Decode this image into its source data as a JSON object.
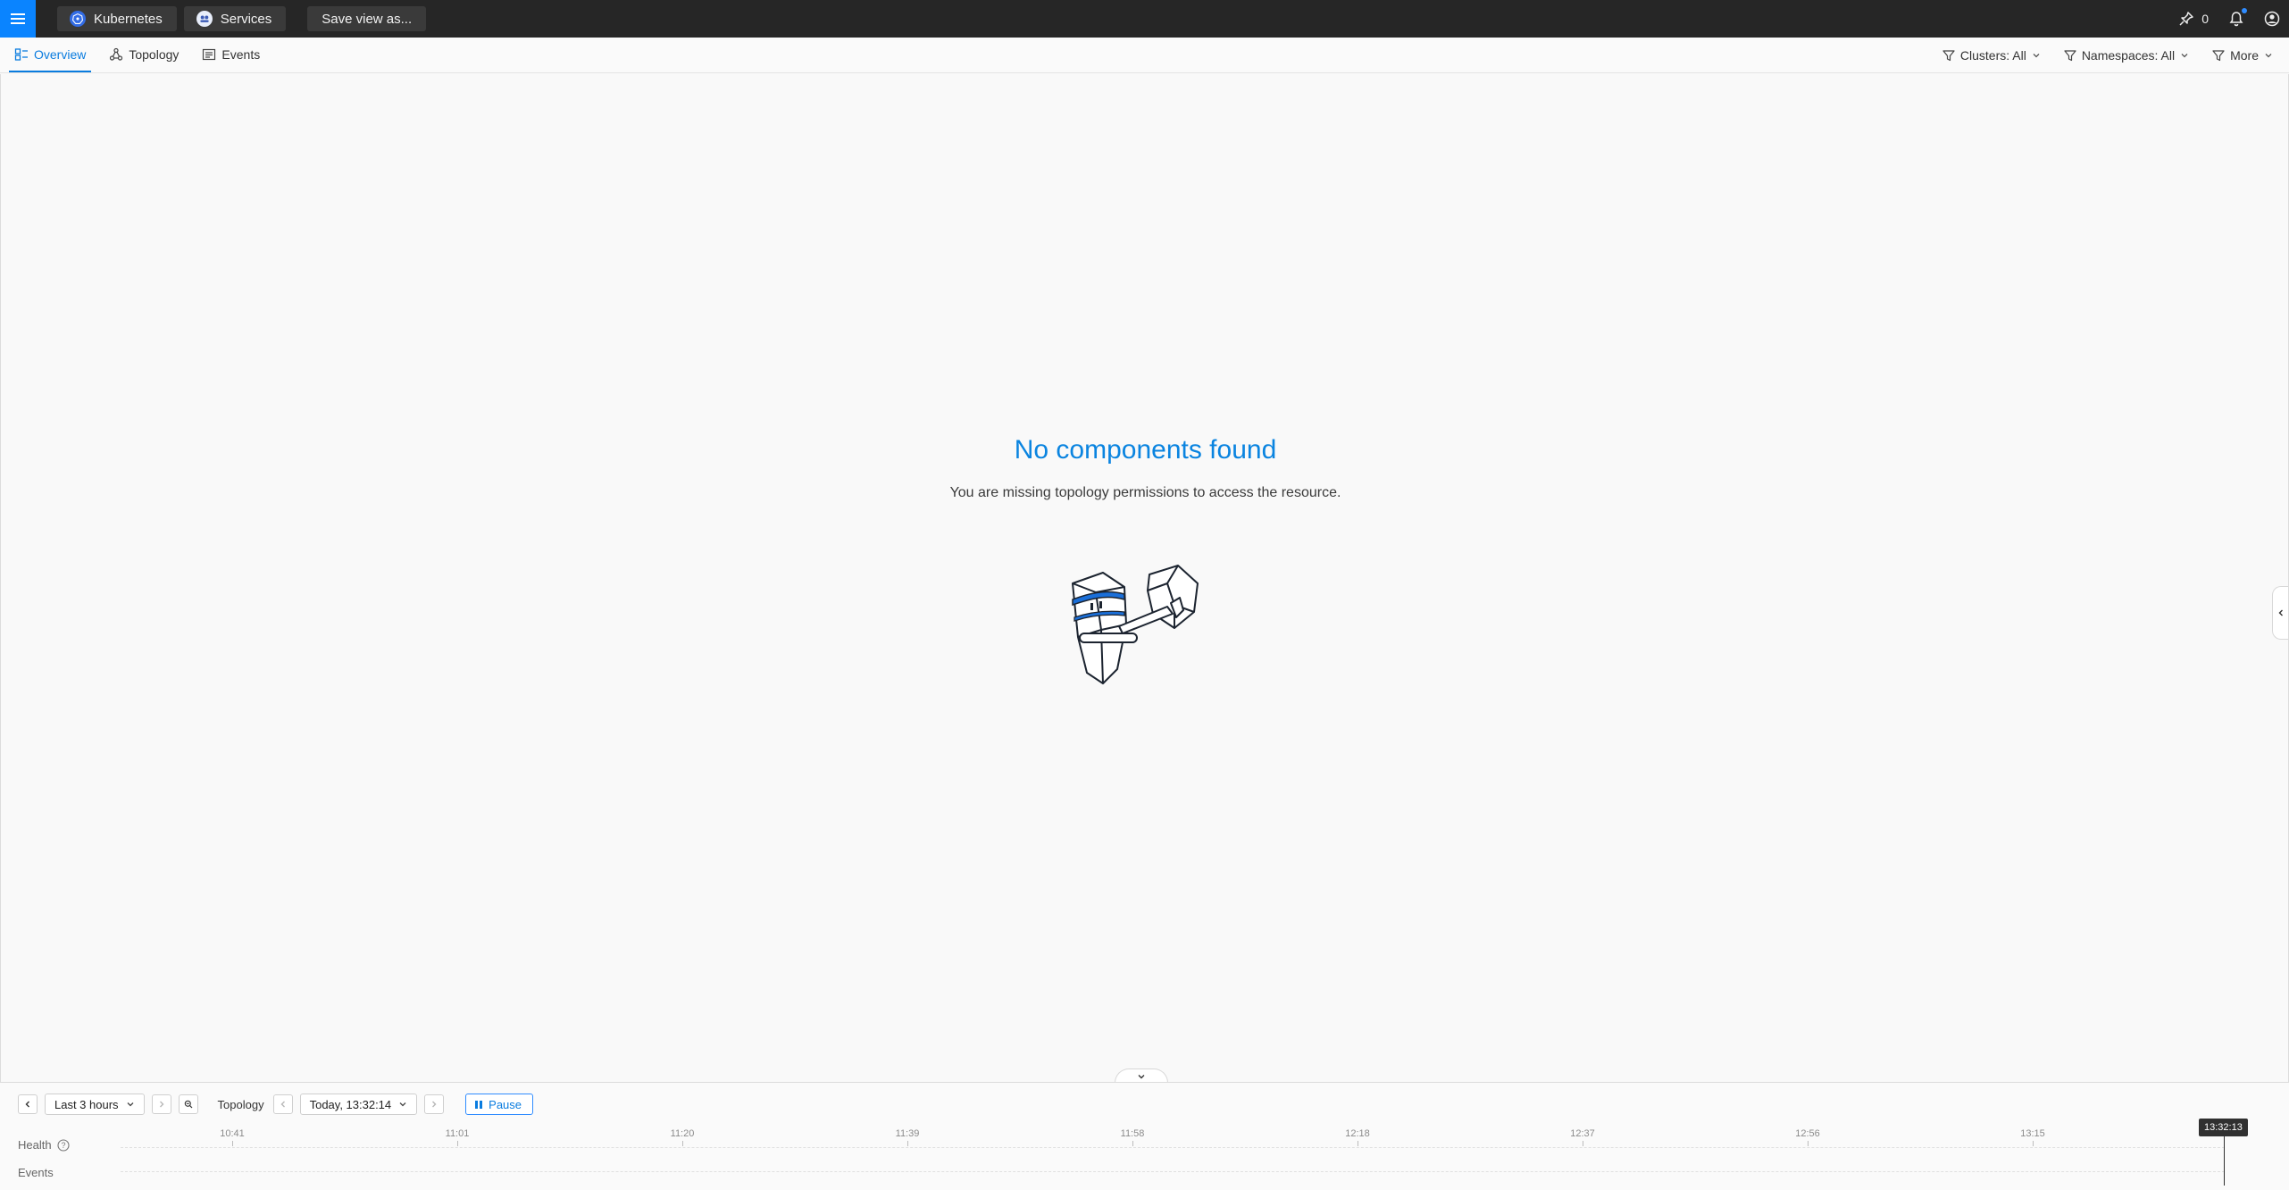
{
  "topbar": {
    "breadcrumbs": [
      {
        "label": "Kubernetes",
        "icon": "kubernetes-icon"
      },
      {
        "label": "Services",
        "icon": "services-icon"
      }
    ],
    "save_label": "Save view as...",
    "pins_count": "0"
  },
  "tabs": [
    {
      "label": "Overview",
      "icon": "overview-icon",
      "active": true
    },
    {
      "label": "Topology",
      "icon": "topology-icon",
      "active": false
    },
    {
      "label": "Events",
      "icon": "events-icon",
      "active": false
    }
  ],
  "filters": [
    {
      "label": "Clusters: All"
    },
    {
      "label": "Namespaces: All"
    },
    {
      "label": "More"
    }
  ],
  "empty_state": {
    "title": "No components found",
    "message": "You are missing topology permissions to access the resource."
  },
  "timeline": {
    "range_label": "Last 3 hours",
    "topology_label": "Topology",
    "time_label": "Today, 13:32:14",
    "pause_label": "Pause",
    "rows": [
      "Health",
      "Events"
    ],
    "ticks": [
      "10:41",
      "11:01",
      "11:20",
      "11:39",
      "11:58",
      "12:18",
      "12:37",
      "12:56",
      "13:15"
    ],
    "now_label": "13:32:13"
  },
  "colors": {
    "accent": "#0a84ff",
    "topbar": "#262626",
    "title": "#0a84e0"
  }
}
